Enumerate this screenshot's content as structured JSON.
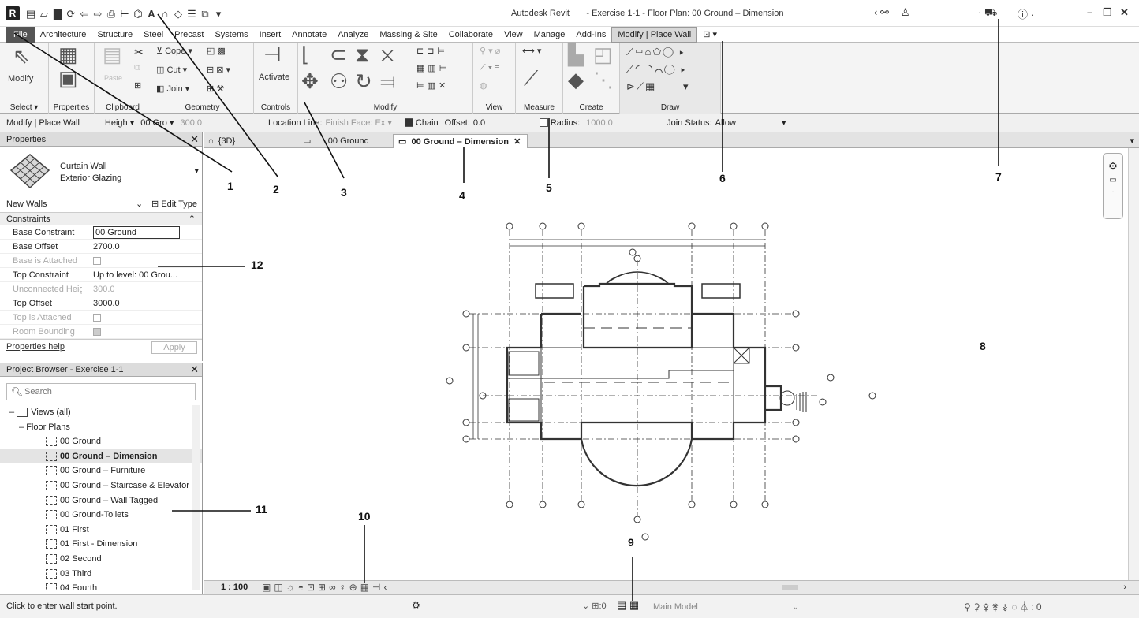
{
  "app": {
    "logo": "R",
    "title": "Autodesk Revit",
    "document": "- Exercise 1-1 - Floor Plan: 00 Ground – Dimension"
  },
  "quick_access_icons": [
    "folder-open-icon",
    "save-icon",
    "sync-icon",
    "undo-icon",
    "redo-icon",
    "print-icon",
    "measure-icon",
    "tag-icon",
    "text-icon",
    "3d-view-icon",
    "section-icon",
    "thin-lines-icon",
    "switch-windows-icon"
  ],
  "ribbon_tabs": [
    "File",
    "Architecture",
    "Structure",
    "Steel",
    "Precast",
    "Systems",
    "Insert",
    "Annotate",
    "Analyze",
    "Massing & Site",
    "Collaborate",
    "View",
    "Manage",
    "Add-Ins",
    "Modify | Place Wall"
  ],
  "ribbon_panels": {
    "select": {
      "label": "Select ▾",
      "modify_button": "Modify"
    },
    "properties": {
      "label": "Properties"
    },
    "clipboard": {
      "label": "Clipboard",
      "paste_button": "Paste"
    },
    "geometry": {
      "label": "Geometry",
      "cope": "Cope",
      "cut": "Cut",
      "join": "Join"
    },
    "controls": {
      "label": "Controls",
      "activate_button": "Activate"
    },
    "modify": {
      "label": "Modify"
    },
    "view": {
      "label": "View"
    },
    "measure": {
      "label": "Measure"
    },
    "create": {
      "label": "Create"
    },
    "draw": {
      "label": "Draw"
    }
  },
  "options_bar": {
    "context": "Modify | Place Wall",
    "height_label": "Heigh",
    "height_level": "00 Gro",
    "height_value": "300.0",
    "location_line_label": "Location Line:",
    "location_line_value": "Finish Face: Ex",
    "chain_label": "Chain",
    "chain_checked": true,
    "offset_label": "Offset:",
    "offset_value": "0.0",
    "radius_label": "Radius:",
    "radius_checked": false,
    "radius_value": "1000.0",
    "join_status_label": "Join Status:",
    "join_status_value": "Allow"
  },
  "properties": {
    "header": "Properties",
    "type_family": "Curtain Wall",
    "type_name": "Exterior Glazing",
    "instance_selector": "New Walls",
    "edit_type": "Edit Type",
    "group_header": "Constraints",
    "rows": [
      {
        "key": "Base Constraint",
        "value": "00 Ground"
      },
      {
        "key": "Base Offset",
        "value": "2700.0"
      },
      {
        "key": "Base is Attached",
        "value": ""
      },
      {
        "key": "Top Constraint",
        "value": "Up to level: 00 Grou..."
      },
      {
        "key": "Unconnected Height",
        "value": "300.0"
      },
      {
        "key": "Top Offset",
        "value": "3000.0"
      },
      {
        "key": "Top is Attached",
        "value": ""
      },
      {
        "key": "Room Bounding",
        "value": ""
      }
    ],
    "help_link": "Properties help",
    "apply_button": "Apply"
  },
  "project_browser": {
    "header": "Project Browser - Exercise 1-1",
    "search_placeholder": "Search",
    "root": "Views (all)",
    "category": "Floor Plans",
    "views": [
      "00 Ground",
      "00 Ground – Dimension",
      "00 Ground – Furniture",
      "00 Ground – Staircase & Elevator",
      "00 Ground – Wall Tagged",
      "00 Ground-Toilets",
      "01 First",
      "01 First - Dimension",
      "02 Second",
      "03 Third",
      "04 Fourth"
    ],
    "selected_index": 1
  },
  "view_tabs": [
    {
      "label": "{3D}"
    },
    {
      "label": "00 Ground"
    },
    {
      "label": "00 Ground – Dimension",
      "active": true
    }
  ],
  "view_control_bar": {
    "scale": "1 : 100"
  },
  "status_bar": {
    "message": "Click to enter wall start point.",
    "worksets": ":0",
    "model": "Main Model",
    "filter_count": ":0"
  },
  "callouts": [
    "1",
    "2",
    "3",
    "4",
    "5",
    "6",
    "7",
    "8",
    "9",
    "10",
    "11",
    "12"
  ]
}
